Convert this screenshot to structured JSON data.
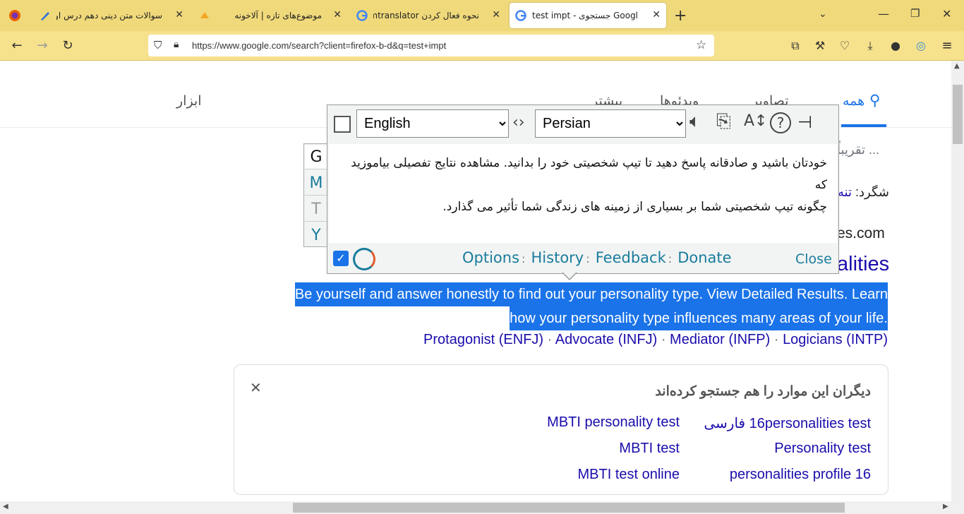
{
  "tabs": [
    {
      "label": "سوالات متن دینی دهم درس اول"
    },
    {
      "label": "موضوع‌های تازه | آلاخونه"
    },
    {
      "label": "نحوه فعال کردن imtranslator برا"
    },
    {
      "label": "test impt - جستجوی Google"
    }
  ],
  "address": {
    "url": "https://www.google.com/search?client=firefox-b-d&q=test+impt"
  },
  "search_nav": {
    "all": "همه",
    "images": "تصاویر",
    "videos": "ویدئوها",
    "more": "بیشتر",
    "tools": "ابزار"
  },
  "results": {
    "stats": "تقریباً ...",
    "student": "شگرد:",
    "student_link": "تنه",
    "site": "es.com",
    "title_tail": "alities",
    "snippet_line1": "Be yourself and answer honestly to find out your personality type. View Detailed Results. Learn",
    "snippet_line2": "how your personality type influences many areas of your life.",
    "sub_links": [
      "Protagonist (ENFJ)",
      "Advocate (INFJ)",
      "Mediator (INFP)",
      "Logicians (INTP)"
    ]
  },
  "people_also_search": {
    "heading": "دیگران این موارد را هم جستجو کرده‌اند",
    "close": "✕",
    "items": [
      "16personalities test فارسی",
      "MBTI personality test",
      "Personality test",
      "MBTI test",
      "16 personalities profile",
      "MBTI test online"
    ]
  },
  "translator": {
    "source_lang": "English",
    "target_lang": "Persian",
    "translation_line1": "خودتان باشید و صادقانه پاسخ دهید تا تیپ شخصیتی خود را بدانید. مشاهده نتایج تفصیلی بیاموزید که",
    "translation_line2": "چگونه تیپ شخصیتی شما بر بسیاری از زمینه های زندگی شما تأثیر می گذارد.",
    "footer": {
      "options": "Options",
      "history": "History",
      "feedback": "Feedback",
      "donate": "Donate",
      "close": "Close"
    },
    "engines": [
      "G",
      "M",
      "T",
      "Y"
    ]
  },
  "colors": {
    "tabbar": "#f0d97a",
    "navbar": "#f6e18c",
    "link": "#1a0dab",
    "selection": "#1a73e8",
    "translator_link": "#1a7c9c"
  }
}
